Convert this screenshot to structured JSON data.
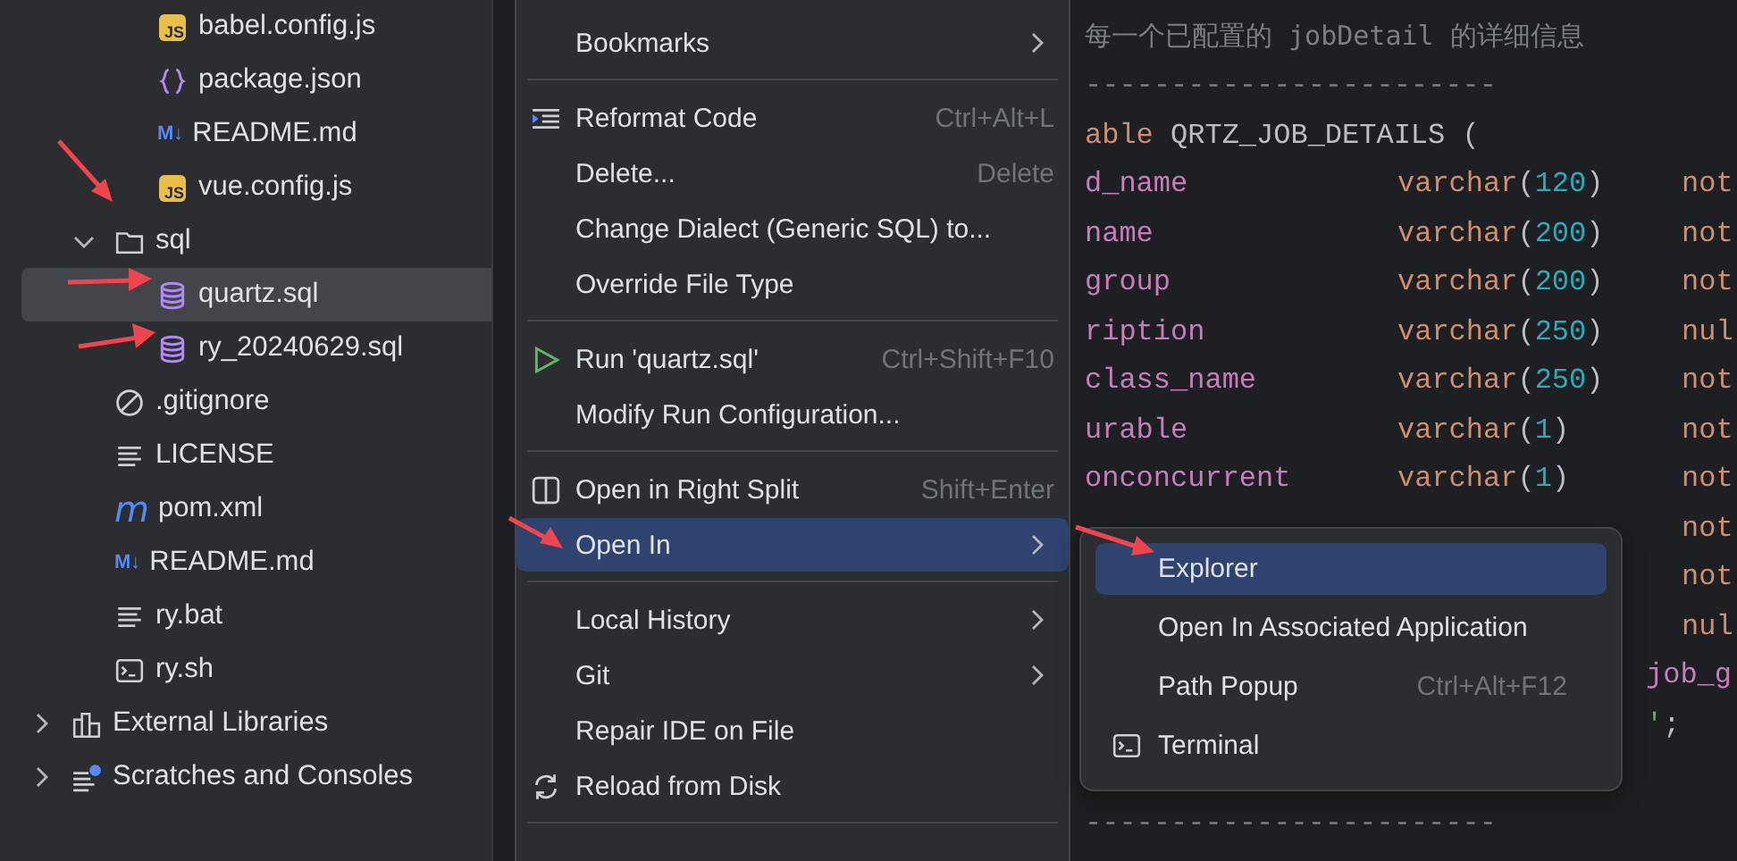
{
  "project_tree": {
    "continued_items": [
      {
        "label": "babel.config.js",
        "kind": "js",
        "badge": "JS",
        "selected": false
      },
      {
        "label": "package.json",
        "kind": "json",
        "selected": false
      },
      {
        "label": "README.md",
        "kind": "md",
        "badge": "M↓",
        "selected": false
      },
      {
        "label": "vue.config.js",
        "kind": "js",
        "badge": "JS",
        "selected": false
      }
    ],
    "items": [
      {
        "label": "sql",
        "kind": "folder",
        "expanded": true,
        "selected": false,
        "children": [
          {
            "label": "quartz.sql",
            "kind": "db",
            "selected": true
          },
          {
            "label": "ry_20240629.sql",
            "kind": "db",
            "selected": false
          }
        ]
      },
      {
        "label": ".gitignore",
        "kind": "ignore",
        "selected": false
      },
      {
        "label": "LICENSE",
        "kind": "text",
        "selected": false
      },
      {
        "label": "pom.xml",
        "kind": "maven",
        "badge": "m",
        "selected": false
      },
      {
        "label": "README.md",
        "kind": "md",
        "badge": "M↓",
        "selected": false
      },
      {
        "label": "ry.bat",
        "kind": "text",
        "selected": false
      },
      {
        "label": "ry.sh",
        "kind": "terminal",
        "selected": false
      }
    ],
    "root_items": [
      {
        "label": "External Libraries",
        "kind": "library",
        "expanded": false,
        "selected": false
      },
      {
        "label": "Scratches and Consoles",
        "kind": "scratches",
        "expanded": false,
        "selected": false
      }
    ]
  },
  "editor": {
    "lines": [
      {
        "kind": "comment",
        "text": "每一个已配置的 jobDetail 的详细信息"
      },
      {
        "kind": "rule",
        "text": "------------------------"
      },
      {
        "kind": "code",
        "cells": [
          [
            {
              "text": "able",
              "kind": "keyword"
            },
            {
              "text": " QRTZ_JOB_DETAILS ",
              "kind": "ident"
            },
            {
              "text": "(",
              "kind": "punct"
            }
          ]
        ]
      },
      {
        "kind": "code",
        "cells": [
          [
            {
              "text": "d_name",
              "kind": "field"
            }
          ],
          [
            {
              "text": "varchar",
              "kind": "keyword"
            },
            {
              "text": "(",
              "kind": "punct"
            },
            {
              "text": "120",
              "kind": "number"
            },
            {
              "text": ")",
              "kind": "punct"
            }
          ],
          [
            {
              "text": "not",
              "kind": "keyword"
            }
          ]
        ]
      },
      {
        "kind": "code",
        "cells": [
          [
            {
              "text": "name",
              "kind": "field"
            }
          ],
          [
            {
              "text": "varchar",
              "kind": "keyword"
            },
            {
              "text": "(",
              "kind": "punct"
            },
            {
              "text": "200",
              "kind": "number"
            },
            {
              "text": ")",
              "kind": "punct"
            }
          ],
          [
            {
              "text": "not",
              "kind": "keyword"
            }
          ]
        ]
      },
      {
        "kind": "code",
        "cells": [
          [
            {
              "text": "group",
              "kind": "field"
            }
          ],
          [
            {
              "text": "varchar",
              "kind": "keyword"
            },
            {
              "text": "(",
              "kind": "punct"
            },
            {
              "text": "200",
              "kind": "number"
            },
            {
              "text": ")",
              "kind": "punct"
            }
          ],
          [
            {
              "text": "not",
              "kind": "keyword"
            }
          ]
        ]
      },
      {
        "kind": "code",
        "cells": [
          [
            {
              "text": "ription",
              "kind": "field"
            }
          ],
          [
            {
              "text": "varchar",
              "kind": "keyword"
            },
            {
              "text": "(",
              "kind": "punct"
            },
            {
              "text": "250",
              "kind": "number"
            },
            {
              "text": ")",
              "kind": "punct"
            }
          ],
          [
            {
              "text": "nul",
              "kind": "keyword"
            }
          ]
        ]
      },
      {
        "kind": "code",
        "cells": [
          [
            {
              "text": "class_name",
              "kind": "field"
            }
          ],
          [
            {
              "text": "varchar",
              "kind": "keyword"
            },
            {
              "text": "(",
              "kind": "punct"
            },
            {
              "text": "250",
              "kind": "number"
            },
            {
              "text": ")",
              "kind": "punct"
            }
          ],
          [
            {
              "text": "not",
              "kind": "keyword"
            }
          ]
        ]
      },
      {
        "kind": "code",
        "cells": [
          [
            {
              "text": "urable",
              "kind": "field"
            }
          ],
          [
            {
              "text": "varchar",
              "kind": "keyword"
            },
            {
              "text": "(",
              "kind": "punct"
            },
            {
              "text": "1",
              "kind": "number"
            },
            {
              "text": ")",
              "kind": "punct"
            }
          ],
          [
            {
              "text": "not",
              "kind": "keyword"
            }
          ]
        ]
      },
      {
        "kind": "code",
        "cells": [
          [
            {
              "text": "onconcurrent",
              "kind": "field"
            }
          ],
          [
            {
              "text": "varchar",
              "kind": "keyword"
            },
            {
              "text": "(",
              "kind": "punct"
            },
            {
              "text": "1",
              "kind": "number"
            },
            {
              "text": ")",
              "kind": "punct"
            }
          ],
          [
            {
              "text": "not",
              "kind": "keyword"
            }
          ]
        ]
      },
      {
        "kind": "code",
        "cells": [
          [],
          [],
          [
            {
              "text": "not",
              "kind": "keyword"
            }
          ]
        ]
      },
      {
        "kind": "code",
        "cells": [
          [],
          [],
          [
            {
              "text": "not",
              "kind": "keyword"
            }
          ]
        ]
      },
      {
        "kind": "code",
        "cells": [
          [],
          [],
          [
            {
              "text": "nul",
              "kind": "keyword"
            }
          ]
        ]
      },
      {
        "kind": "code",
        "cells": [
          [],
          [],
          [
            {
              "text": "job_g",
              "kind": "field"
            }
          ]
        ]
      },
      {
        "kind": "code",
        "cells": [
          [],
          [],
          [
            {
              "text": "'",
              "kind": "string"
            },
            {
              "text": ";",
              "kind": "punct"
            }
          ]
        ]
      },
      {
        "kind": "blank"
      },
      {
        "kind": "rule",
        "text": "------------------------"
      }
    ]
  },
  "context_menu": {
    "groups": [
      {
        "items": [
          {
            "label": "Bookmarks",
            "kind": "plain",
            "submenu": true,
            "selected": false
          }
        ]
      },
      {
        "items": [
          {
            "label": "Reformat Code",
            "kind": "reformat",
            "shortcut": "Ctrl+Alt+L",
            "submenu": false,
            "selected": false
          },
          {
            "label": "Delete...",
            "kind": "plain",
            "shortcut": "Delete",
            "submenu": false,
            "selected": false
          },
          {
            "label": "Change Dialect (Generic SQL) to...",
            "kind": "plain",
            "submenu": false,
            "selected": false
          },
          {
            "label": "Override File Type",
            "kind": "plain",
            "submenu": false,
            "selected": false
          }
        ]
      },
      {
        "items": [
          {
            "label": "Run 'quartz.sql'",
            "kind": "run",
            "shortcut": "Ctrl+Shift+F10",
            "submenu": false,
            "selected": false
          },
          {
            "label": "Modify Run Configuration...",
            "kind": "plain",
            "submenu": false,
            "selected": false
          }
        ]
      },
      {
        "items": [
          {
            "label": "Open in Right Split",
            "kind": "split",
            "shortcut": "Shift+Enter",
            "submenu": false,
            "selected": false
          },
          {
            "label": "Open In",
            "kind": "plain",
            "submenu": true,
            "selected": true
          }
        ]
      },
      {
        "items": [
          {
            "label": "Local History",
            "kind": "plain",
            "submenu": true,
            "selected": false
          },
          {
            "label": "Git",
            "kind": "plain",
            "submenu": true,
            "selected": false
          },
          {
            "label": "Repair IDE on File",
            "kind": "plain",
            "submenu": false,
            "selected": false
          },
          {
            "label": "Reload from Disk",
            "kind": "reload",
            "submenu": false,
            "selected": false
          }
        ]
      }
    ]
  },
  "submenu": {
    "items": [
      {
        "label": "Explorer",
        "kind": "plain",
        "selected": true
      },
      {
        "label": "Open In Associated Application",
        "kind": "plain",
        "selected": false
      },
      {
        "label": "Path Popup",
        "kind": "plain",
        "shortcut": "Ctrl+Alt+F12",
        "selected": false
      },
      {
        "label": "Terminal",
        "kind": "terminal",
        "selected": false
      }
    ]
  }
}
